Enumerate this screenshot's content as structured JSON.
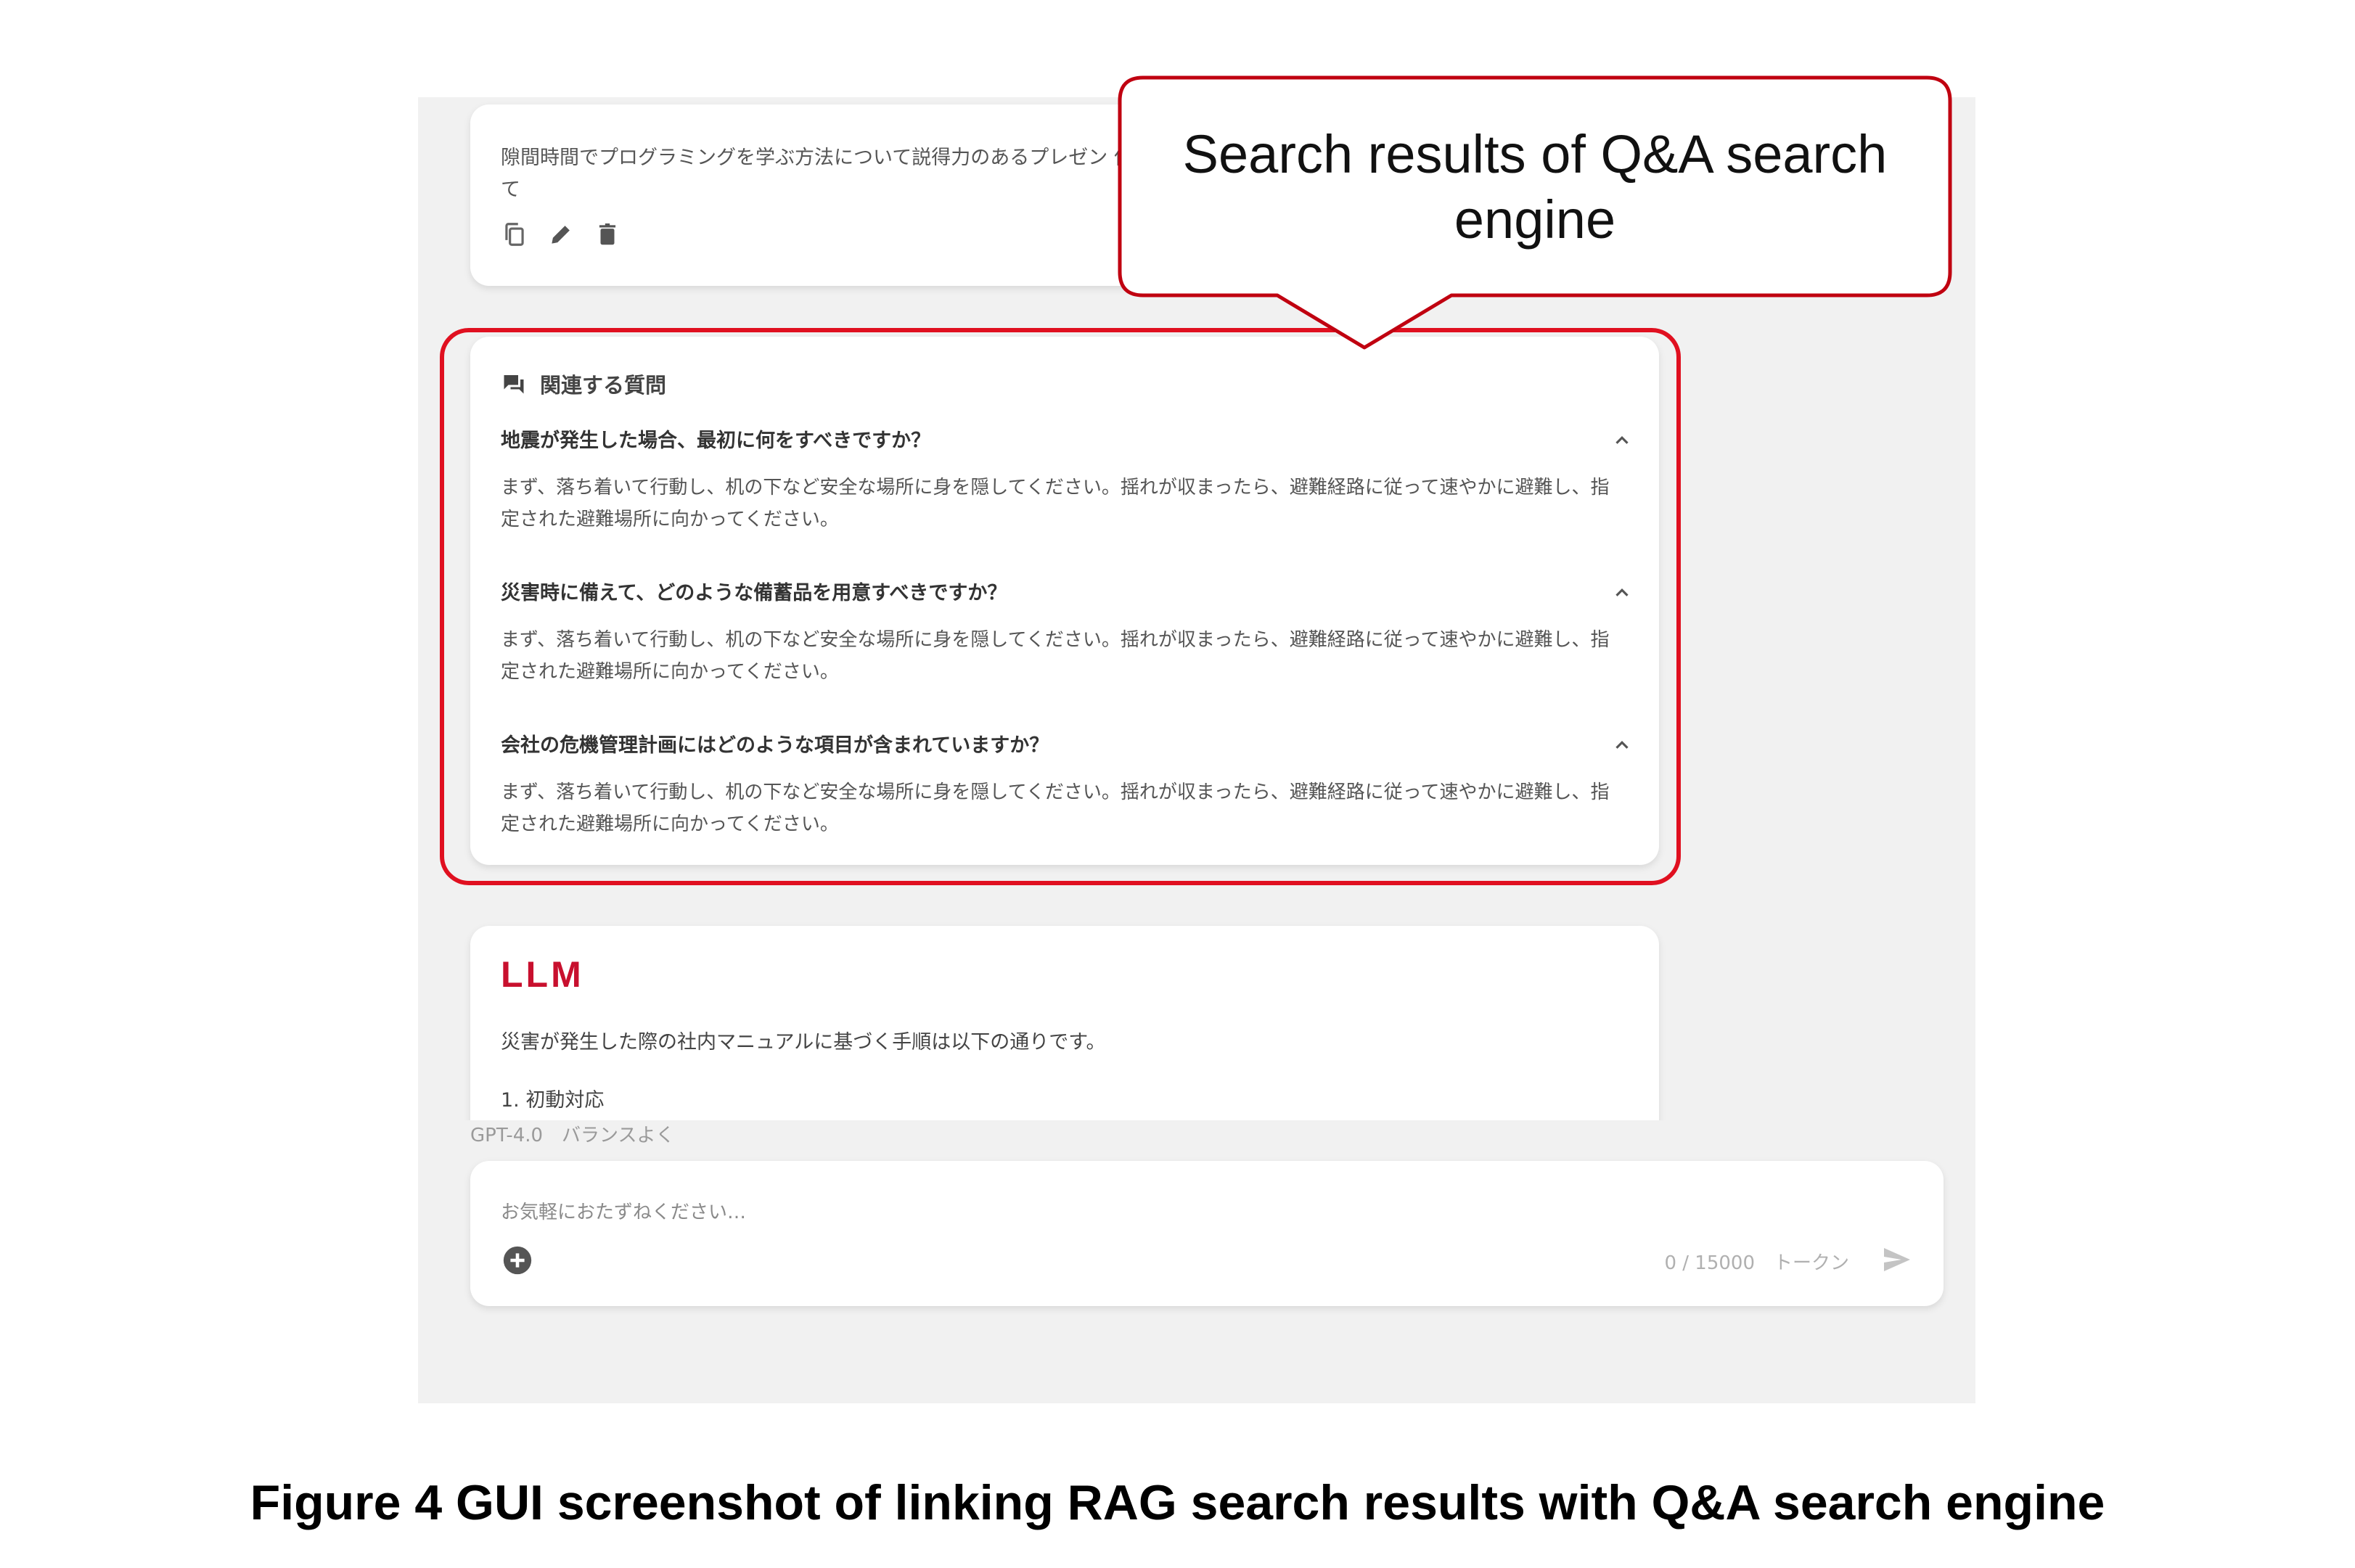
{
  "prompt": {
    "text": "隙間時間でプログラミングを学ぶ方法について説得力のあるプレゼン 作って"
  },
  "related": {
    "title": "関連する質問",
    "items": [
      {
        "question": "地震が発生した場合、最初に何をすべきですか？",
        "answer": "まず、落ち着いて行動し、机の下など安全な場所に身を隠してください。揺れが収まったら、避難経路に従って速やかに避難し、指定された避難場所に向かってください。"
      },
      {
        "question": "災害時に備えて、どのような備蓄品を用意すべきですか？",
        "answer": "まず、落ち着いて行動し、机の下など安全な場所に身を隠してください。揺れが収まったら、避難経路に従って速やかに避難し、指定された避難場所に向かってください。"
      },
      {
        "question": "会社の危機管理計画にはどのような項目が含まれていますか？",
        "answer": "まず、落ち着いて行動し、机の下など安全な場所に身を隠してください。揺れが収まったら、避難経路に従って速やかに避難し、指定された避難場所に向かってください。"
      }
    ]
  },
  "answer": {
    "logo": "LLM",
    "intro": "災害が発生した際の社内マニュアルに基づく手順は以下の通りです。",
    "step1": "1. 初動対応"
  },
  "model_info": "GPT-4.0　バランスよく",
  "input": {
    "placeholder": "お気軽におたずねください…",
    "token_count": "0 / 15000　トークン"
  },
  "callout": {
    "text": "Search results of Q&A search engine"
  },
  "caption": "Figure 4  GUI screenshot of linking RAG search results with Q&A search engine",
  "colors": {
    "highlight": "#e01020",
    "callout_border": "#c00010",
    "llm_logo": "#c8102e",
    "app_bg": "#f1f1f1"
  },
  "icons": [
    "copy-icon",
    "edit-icon",
    "trash-icon",
    "chat-bubbles-icon",
    "chevron-up-icon",
    "add-circle-icon",
    "send-icon"
  ]
}
